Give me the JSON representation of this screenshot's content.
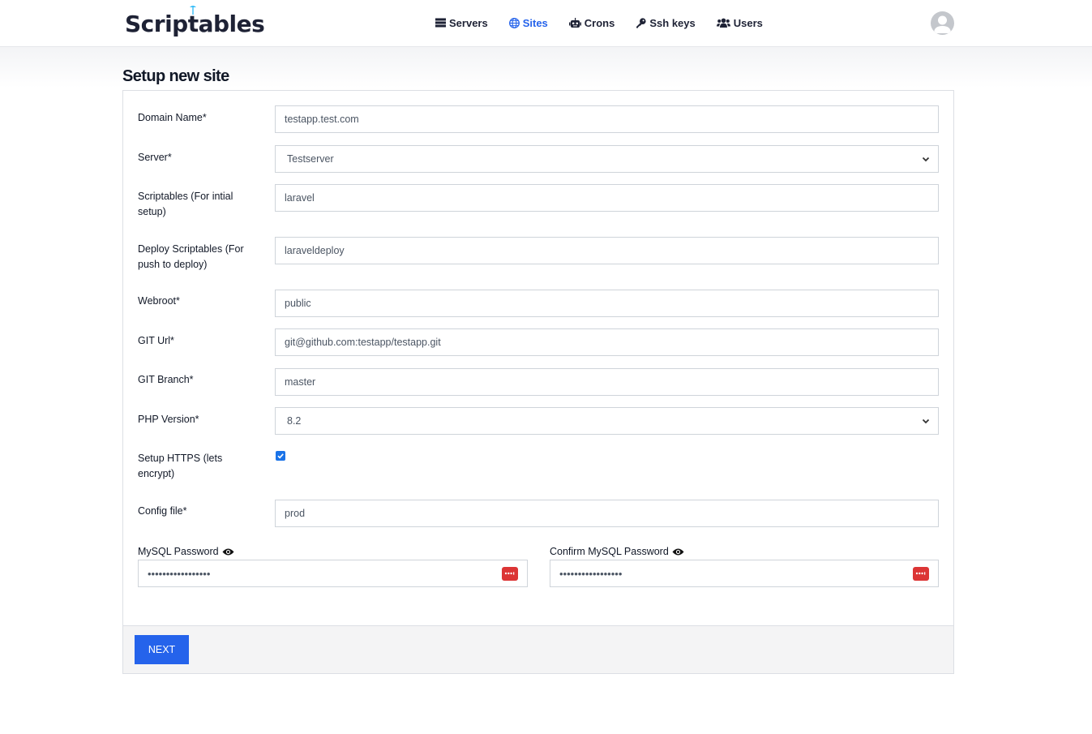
{
  "brand": {
    "name": "Scriptables"
  },
  "nav": {
    "items": [
      {
        "label": "Servers",
        "icon": "server-icon"
      },
      {
        "label": "Sites",
        "icon": "globe-icon",
        "active": true
      },
      {
        "label": "Crons",
        "icon": "robot-icon"
      },
      {
        "label": "Ssh keys",
        "icon": "key-icon"
      },
      {
        "label": "Users",
        "icon": "users-icon"
      }
    ]
  },
  "colors": {
    "accent": "#2563eb",
    "danger": "#dc3535",
    "text": "#1e2235"
  },
  "page": {
    "title": "Setup new site"
  },
  "form": {
    "domain": {
      "label": "Domain Name*",
      "value": "testapp.test.com"
    },
    "server": {
      "label": "Server*",
      "value": "Testserver"
    },
    "scriptables": {
      "label": "Scriptables (For intial setup)",
      "value": "laravel"
    },
    "deploy": {
      "label": "Deploy Scriptables (For push to deploy)",
      "value": "laraveldeploy"
    },
    "webroot": {
      "label": "Webroot*",
      "value": "public"
    },
    "git_url": {
      "label": "GIT Url*",
      "value": "git@github.com:testapp/testapp.git"
    },
    "git_branch": {
      "label": "GIT Branch*",
      "value": "master"
    },
    "php_version": {
      "label": "PHP Version*",
      "value": "8.2"
    },
    "https": {
      "label": "Setup HTTPS (lets encrypt)",
      "checked": true
    },
    "config": {
      "label": "Config file*",
      "value": "prod"
    },
    "mysql_password": {
      "label": "MySQL Password",
      "value": "•••••••••••••••••"
    },
    "mysql_confirm": {
      "label": "Confirm MySQL Password",
      "value": "•••••••••••••••••"
    }
  },
  "footer": {
    "next_label": "NEXT"
  }
}
